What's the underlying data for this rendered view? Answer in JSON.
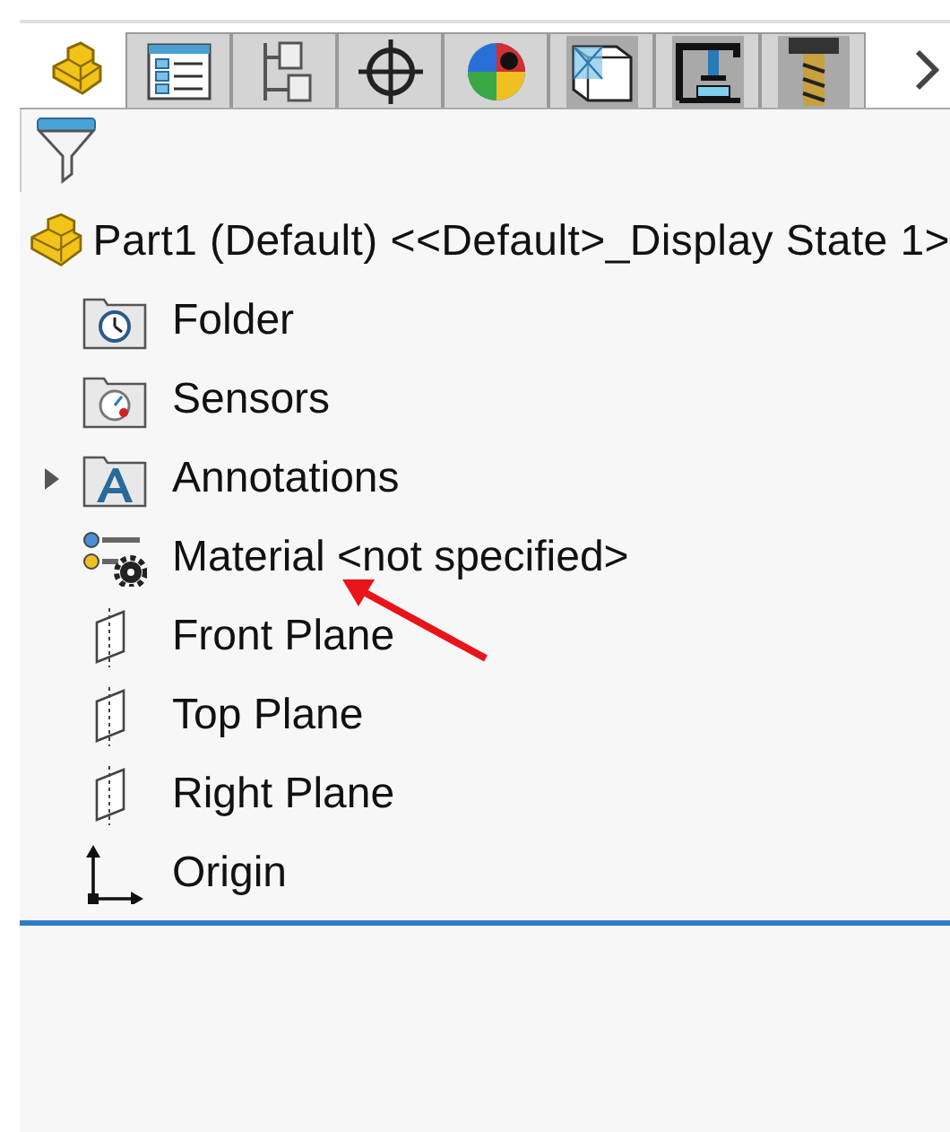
{
  "tabs": [
    {
      "kind": "part",
      "selected": true
    },
    {
      "kind": "properties",
      "selected": false
    },
    {
      "kind": "configurations",
      "selected": false
    },
    {
      "kind": "crosshair",
      "selected": false
    },
    {
      "kind": "appearance",
      "selected": false
    },
    {
      "kind": "cube",
      "selected": false
    },
    {
      "kind": "press",
      "selected": false
    },
    {
      "kind": "tool",
      "selected": false
    }
  ],
  "tree": {
    "label": "Part1 (Default) <<Default>_Display State 1>",
    "children": [
      {
        "kind": "history-folder",
        "label": "Folder"
      },
      {
        "kind": "sensor-folder",
        "label": "Sensors"
      },
      {
        "kind": "annotation-folder",
        "label": "Annotations",
        "expanded": false
      },
      {
        "kind": "material",
        "label": "Material <not specified>"
      },
      {
        "kind": "plane",
        "label": "Front Plane"
      },
      {
        "kind": "plane",
        "label": "Top Plane"
      },
      {
        "kind": "plane",
        "label": "Right Plane"
      },
      {
        "kind": "origin",
        "label": "Origin"
      }
    ]
  }
}
